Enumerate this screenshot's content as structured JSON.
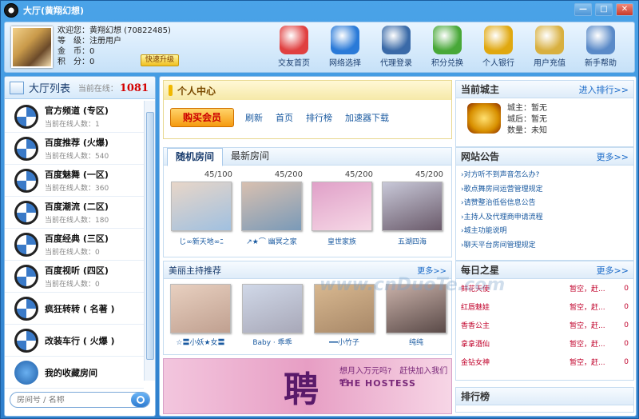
{
  "window": {
    "title": "大厅(黄翔幻想)",
    "min": "—",
    "restore": "□",
    "close": "✕"
  },
  "user": {
    "welcome": "欢迎您：黄翔幻想 (70822485)",
    "level": "等　级：注册用户",
    "gold": "金　币：0",
    "points": "积　分：0",
    "upgrade": "快速升级"
  },
  "nav": [
    {
      "label": "交友首页",
      "icon": "house-heart-icon",
      "color": "#e04040"
    },
    {
      "label": "网络选择",
      "icon": "globe-icon",
      "color": "#2a7ad8"
    },
    {
      "label": "代理登录",
      "icon": "chart-monitor-icon",
      "color": "#3a6aa8"
    },
    {
      "label": "积分兑换",
      "icon": "gift-icon",
      "color": "#48a838"
    },
    {
      "label": "个人银行",
      "icon": "gold-coins-icon",
      "color": "#e0a810"
    },
    {
      "label": "用户充值",
      "icon": "money-bag-icon",
      "color": "#d8b040"
    },
    {
      "label": "新手帮助",
      "icon": "people-help-icon",
      "color": "#5a8ac8"
    }
  ],
  "sidebar": {
    "title": "大厅列表",
    "online_label": "当前在线：",
    "online_count": "1081",
    "rooms": [
      {
        "name": "官方频道 (专区)",
        "sub": "当前在线人数：1"
      },
      {
        "name": "百度推荐 (火爆)",
        "sub": "当前在线人数：540"
      },
      {
        "name": "百度魅舞 (一区)",
        "sub": "当前在线人数：360"
      },
      {
        "name": "百度潮流 (二区)",
        "sub": "当前在线人数：180"
      },
      {
        "name": "百度经典 (三区)",
        "sub": "当前在线人数：0"
      },
      {
        "name": "百度视听 (四区)",
        "sub": "当前在线人数：0"
      },
      {
        "name": "疯狂转转 ( 名著 )",
        "sub": ""
      },
      {
        "name": "改装车行 ( 火爆 )",
        "sub": ""
      },
      {
        "name": "我的收藏房间",
        "sub": ""
      }
    ],
    "search_placeholder": "房间号 / 名称"
  },
  "personal_center": {
    "title": "个人中心",
    "buy": "购买会员",
    "links": [
      "刷新",
      "首页",
      "排行榜",
      "加速器下载"
    ]
  },
  "rooms_tabs": {
    "tabs": [
      "随机房间",
      "最新房间"
    ],
    "cards": [
      {
        "count": "45/100",
        "name": "じ∞新天地∞ﾆ",
        "colors": [
          "#e8d6c8",
          "#a0c0e0"
        ]
      },
      {
        "count": "45/200",
        "name": "↗★⌒ 幽冥之家",
        "colors": [
          "#d8c0b0",
          "#7a9ab8"
        ]
      },
      {
        "count": "45/200",
        "name": "皇世家族",
        "colors": [
          "#e0a0c8",
          "#f6d8e6"
        ]
      },
      {
        "count": "45/200",
        "name": "五湖四海",
        "colors": [
          "#c8c8d8",
          "#6a5a6a"
        ]
      }
    ]
  },
  "hosts": {
    "title": "美丽主持推荐",
    "more": "更多>>",
    "cards": [
      {
        "name": "☆〓小妖★女〓",
        "colors": [
          "#e8d0c0",
          "#c0a090"
        ]
      },
      {
        "name": "Baby · 乖乖",
        "colors": [
          "#d0d8e8",
          "#a8a8b8"
        ]
      },
      {
        "name": "━━小竹子",
        "colors": [
          "#d8b890",
          "#a88868"
        ]
      },
      {
        "name": "纯纯",
        "colors": [
          "#c8b0a8",
          "#5a4a48"
        ]
      }
    ]
  },
  "banner": {
    "big": "聘",
    "t1": "想月入万元吗?　赶快加入我们吧",
    "t2": "THE HOSTESS"
  },
  "city_lord": {
    "title": "当前城主",
    "more": "进入排行>>",
    "lord": "城主：暂无",
    "queen": "城后：暂无",
    "count": "数量：未知"
  },
  "notices": {
    "title": "网站公告",
    "more": "更多>>",
    "items": [
      "›对方听不到声音怎么办?",
      "›歌点舞房间运营管理规定",
      "›请赞整治低俗信息公告",
      "›主持人及代理商申请流程",
      "›城主功能说明",
      "›聊天平台房间管理规定"
    ]
  },
  "stars": {
    "title": "每日之星",
    "more": "更多>>",
    "rows": [
      {
        "a": "鲜花天使",
        "b": "暂空，赶...",
        "c": "0"
      },
      {
        "a": "红唇魅娃",
        "b": "暂空，赶...",
        "c": "0"
      },
      {
        "a": "香香公主",
        "b": "暂空，赶...",
        "c": "0"
      },
      {
        "a": "拿拿酒仙",
        "b": "暂空，赶...",
        "c": "0"
      },
      {
        "a": "金钻女神",
        "b": "暂空，赶...",
        "c": "0"
      }
    ]
  },
  "rank": {
    "title": "排行榜"
  },
  "watermark": "www.cnDuoTe.com"
}
